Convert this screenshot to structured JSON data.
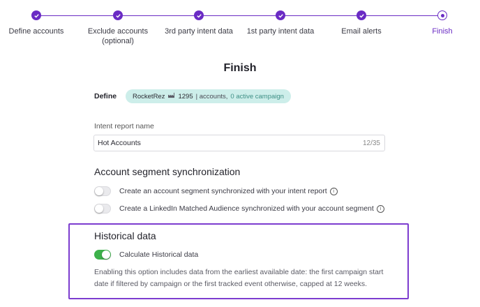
{
  "stepper": {
    "steps": [
      {
        "label": "Define accounts",
        "state": "done"
      },
      {
        "label": "Exclude accounts",
        "sublabel": "(optional)",
        "state": "done"
      },
      {
        "label": "3rd party intent data",
        "state": "done"
      },
      {
        "label": "1st party intent data",
        "state": "done"
      },
      {
        "label": "Email alerts",
        "state": "done"
      },
      {
        "label": "Finish",
        "state": "current"
      }
    ]
  },
  "page": {
    "title": "Finish"
  },
  "define": {
    "label": "Define",
    "chip": {
      "name": "RocketRez",
      "icon": "factory-icon",
      "count": "1295",
      "accounts": "| accounts,",
      "campaigns": "0 active campaign"
    }
  },
  "intent_report": {
    "label": "Intent report name",
    "value": "Hot Accounts",
    "counter": "12/35"
  },
  "segment_sync": {
    "title": "Account segment synchronization",
    "options": [
      {
        "label": "Create an account segment synchronized with your intent report",
        "on": false
      },
      {
        "label": "Create a LinkedIn Matched Audience synchronized with your account segment",
        "on": false
      }
    ]
  },
  "historical": {
    "title": "Historical data",
    "toggle_label": "Calculate Historical data",
    "toggle_on": true,
    "description": "Enabling this option includes data from the earliest available date: the first campaign start date if filtered by campaign or the first tracked event otherwise, capped at 12 weeks."
  },
  "colors": {
    "accent": "#6a2bc4",
    "chip_bg": "#cdeeea",
    "toggle_on": "#3db14b",
    "highlight_border": "#7c3ccf"
  }
}
